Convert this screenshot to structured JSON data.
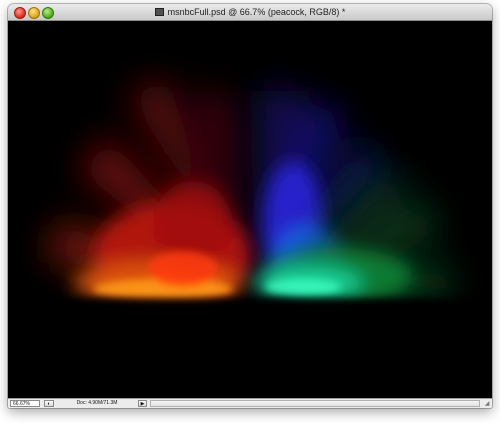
{
  "window": {
    "title": "msnbcFull.psd @ 66.7% (peacock, RGB/8) *"
  },
  "status_bar": {
    "zoom_value": "66.67%",
    "doc_info": "Doc: 4.90M/71.3M",
    "menu_arrow": "▶",
    "stepper_glyph": "◐",
    "resize_glyph": "◢"
  },
  "canvas": {
    "background": "#000000",
    "glow_colors": [
      "#ff9a1a",
      "#e8200a",
      "#8c0a14",
      "#2a23d8",
      "#1a7aff",
      "#19d9a0",
      "#0b8a3a"
    ]
  }
}
